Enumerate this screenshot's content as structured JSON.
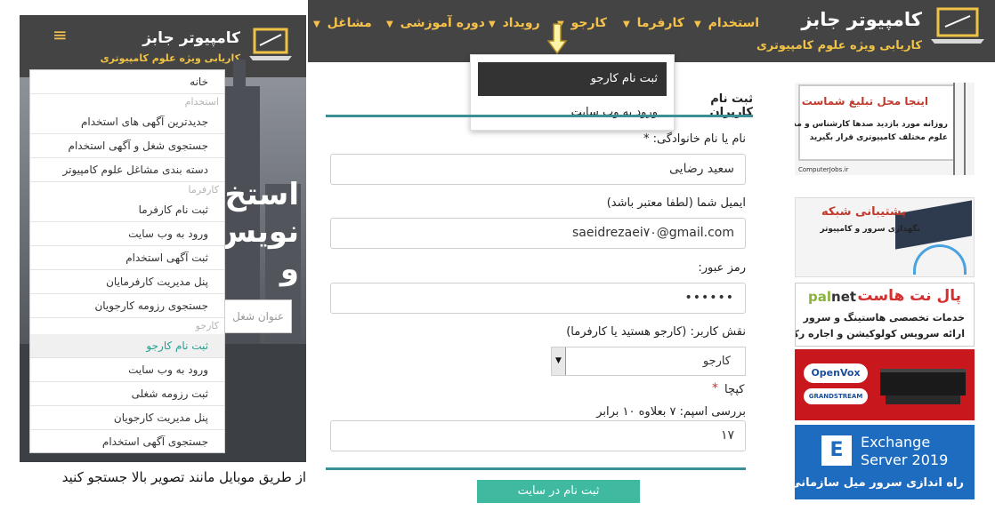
{
  "brand": {
    "name": "کامپیوتر جابز",
    "tagline": "کاریابی ویژه علوم کامپیوتری"
  },
  "nav": {
    "items": [
      "استخدام",
      "کارفرما",
      "کارجو",
      "رویداد",
      "دوره آموزشی",
      "مشاغل"
    ]
  },
  "dropdown": {
    "items": [
      "ثبت نام کارجو",
      "ورود به وب سایت"
    ]
  },
  "mobile": {
    "brand_name": "کامپیوتر جابز",
    "brand_tagline": "کاریابی ویژه علوم کامپیوتری",
    "hamburger": "≡",
    "hero_lines": [
      "استخ",
      "نویس",
      "و"
    ],
    "search_placeholder": "عنوان شغل",
    "menu": [
      {
        "type": "link",
        "label": "خانه"
      },
      {
        "type": "head",
        "label": "استخدام"
      },
      {
        "type": "link",
        "label": "جدیدترین آگهی های استخدام"
      },
      {
        "type": "link",
        "label": "جستجوی شغل و آگهی استخدام"
      },
      {
        "type": "link",
        "label": "دسته بندی مشاغل علوم کامپیوتر"
      },
      {
        "type": "head",
        "label": "کارفرما"
      },
      {
        "type": "link",
        "label": "ثبت نام کارفرما"
      },
      {
        "type": "link",
        "label": "ورود به وب سایت"
      },
      {
        "type": "link",
        "label": "ثبت آگهی استخدام"
      },
      {
        "type": "link",
        "label": "پنل مدیریت کارفرمایان"
      },
      {
        "type": "link",
        "label": "جستجوی رزومه کارجویان"
      },
      {
        "type": "head",
        "label": "کارجو"
      },
      {
        "type": "link",
        "label": "ثبت نام کارجو",
        "active": true
      },
      {
        "type": "link",
        "label": "ورود به وب سایت"
      },
      {
        "type": "link",
        "label": "ثبت رزومه شغلی"
      },
      {
        "type": "link",
        "label": "پنل مدیریت کارجویان"
      },
      {
        "type": "link",
        "label": "جستجوی آگهی استخدام"
      }
    ]
  },
  "caption": "از طریق موبایل مانند تصویر بالا جستجو کنید",
  "form": {
    "title": "ثبت نام کاربران",
    "name_label": "نام یا نام خانوادگی: *",
    "name_value": "سعید رضایی",
    "email_label": "ایمیل شما (لطفا معتبر باشد)",
    "email_value": "saeidrezaei۷۰@gmail.com",
    "password_label": "رمز عبور:",
    "password_value": "••••••",
    "role_label": "نقش کاربر: (کارجو هستید یا کارفرما)",
    "role_value": "کارجو",
    "captcha_label": "کپچا",
    "captcha_star": "*",
    "captcha_question": "بررسی اسپم: ۷ بعلاوه ۱۰ برابر",
    "captcha_value": "۱۷",
    "submit_label": "ثبت نام در سایت"
  },
  "ads": {
    "ad1": {
      "title": "اینجا محل تبلیغ شماست",
      "line1": "روزانه مورد بازدید صدها کارشناس و مدیر",
      "line2": "علوم مختلف کامپیوتری قرار بگیرید",
      "site": "ComputerJobs.ir"
    },
    "ad2": {
      "title": "پشتیبانی شبکه",
      "line1": "نگهداری سرور و کامپیوتر"
    },
    "ad3": {
      "logo_a": "pal",
      "logo_b": "net",
      "title": "پال نت هاست",
      "line1": "خدمات تخصصی هاستینگ و سرور",
      "line2": "ارائه سرویس کولوکیشن و اجاره رک"
    },
    "ad4": {
      "logo1": "OpenVox",
      "logo2": "GRANDSTREAM"
    },
    "ad5": {
      "icon": "E",
      "line1": "Exchange",
      "line2": "Server 2019",
      "line3": "راه اندازی سرور میل سازمانی"
    }
  },
  "colors": {
    "nav_bg": "#444444",
    "nav_text": "#f6c24a",
    "accent": "#3fb9a0",
    "rule": "#3b8f96"
  }
}
